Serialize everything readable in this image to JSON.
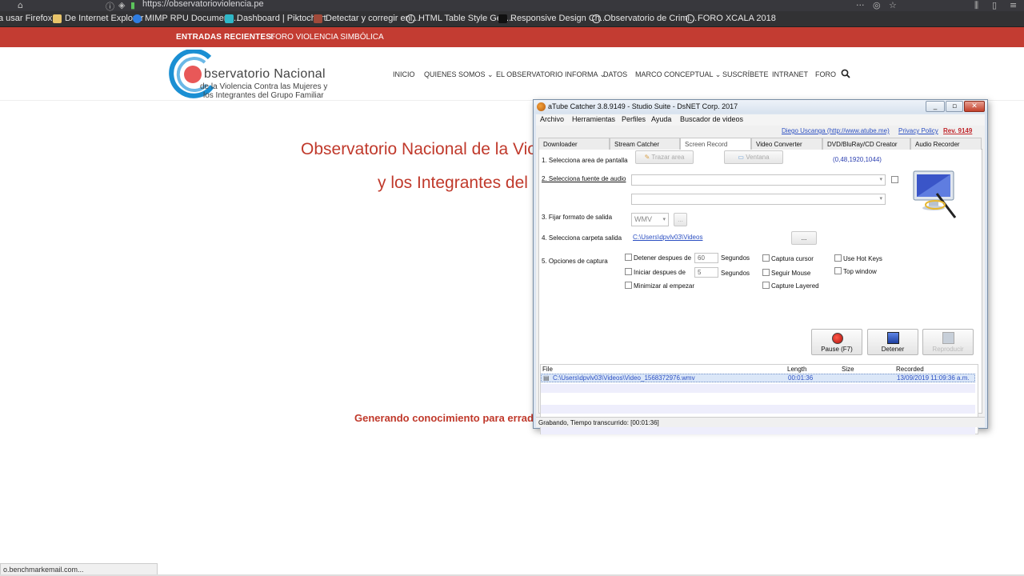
{
  "browser": {
    "url": "https://observatorioviolencia.pe",
    "bookmarks": [
      {
        "label": "a usar Firefox"
      },
      {
        "label": "De Internet Explorer"
      },
      {
        "label": "MIMP RPU Document..."
      },
      {
        "label": "Dashboard | Piktochart"
      },
      {
        "label": "Detectar y corregir enl..."
      },
      {
        "label": "HTML Table Style Gen..."
      },
      {
        "label": "Responsive Design Ch..."
      },
      {
        "label": "Observatorio de Crimi..."
      },
      {
        "label": "FORO XCALA 2018"
      }
    ],
    "status_url": "o.benchmarkemail.com..."
  },
  "site": {
    "recent_label": "ENTRADAS RECIENTES:",
    "recent_link": "FORO VIOLENCIA SIMBÓLICA",
    "logo_title": "bservatorio Nacional",
    "logo_line1": "de la Violencia Contra las Mujeres y",
    "logo_line2": "los Integrantes del Grupo Familiar",
    "nav": [
      {
        "label": "INICIO"
      },
      {
        "label": "QUIENES SOMOS"
      },
      {
        "label": "EL OBSERVATORIO INFORMA"
      },
      {
        "label": "DATOS"
      },
      {
        "label": "MARCO CONCEPTUAL"
      },
      {
        "label": "SUSCRÍBETE"
      },
      {
        "label": "INTRANET"
      },
      {
        "label": "FORO"
      }
    ],
    "hero_line1": "Observatorio Nacional de la Violen",
    "hero_line2": "y los Integrantes del G",
    "tagline": "Generando conocimiento  para erradi",
    "colors": {
      "brand_red": "#c33c32",
      "brand_blue": "#1a8fd3"
    }
  },
  "app": {
    "title": "aTube Catcher 3.8.9149 - Studio Suite - DsNET Corp. 2017",
    "menu": [
      "Archivo",
      "Herramientas",
      "Perfiles",
      "Ayuda",
      "Buscador de videos"
    ],
    "links": {
      "author": "Diego Uscanga (http://www.atube.me)",
      "privacy": "Privacy Policy",
      "rev": "Rev. 9149"
    },
    "tabs": [
      "Downloader",
      "Stream Catcher",
      "Screen Record",
      "Video Converter",
      "DVD/BluRay/CD Creator",
      "Audio Recorder"
    ],
    "active_tab": "Screen Record",
    "step1": "1. Selecciona area de pantalla",
    "btn_trazar": "Trazar area",
    "btn_ventana": "Ventana",
    "area_coords": "(0,48,1920,1044)",
    "step2": "2. Selecciona fuente de audio",
    "step3": "3. Fijar formato de salida",
    "format": "WMV",
    "format_more": "...",
    "step4": "4. Selecciona carpeta salida",
    "folder": "C:\\Users\\dpvlv03\\Videos",
    "browse": "...",
    "step5": "5. Opciones de captura",
    "opt_stop": "Detener despues de",
    "opt_stop_val": "60",
    "opt_start": "Iniciar despues de",
    "opt_start_val": "5",
    "seconds": "Segundos",
    "opt_min": "Minimizar al empezar",
    "opt_cursor": "Captura cursor",
    "opt_follow": "Seguir Mouse",
    "opt_layered": "Capture Layered",
    "opt_hotkeys": "Use Hot Keys",
    "opt_top": "Top window",
    "btn_pause": "Pause (F7)",
    "btn_stop": "Detener",
    "btn_play": "Reproducir",
    "cols": {
      "file": "File",
      "length": "Length",
      "size": "Size",
      "recorded": "Recorded"
    },
    "row": {
      "file": "C:\\Users\\dpvlv03\\Videos\\Video_1568372976.wmv",
      "length": "00:01:36",
      "size": "",
      "recorded": "13/09/2019 11:09:36 a.m."
    },
    "status": "Grabando, Tiempo transcurrido: [00:01:36]"
  }
}
